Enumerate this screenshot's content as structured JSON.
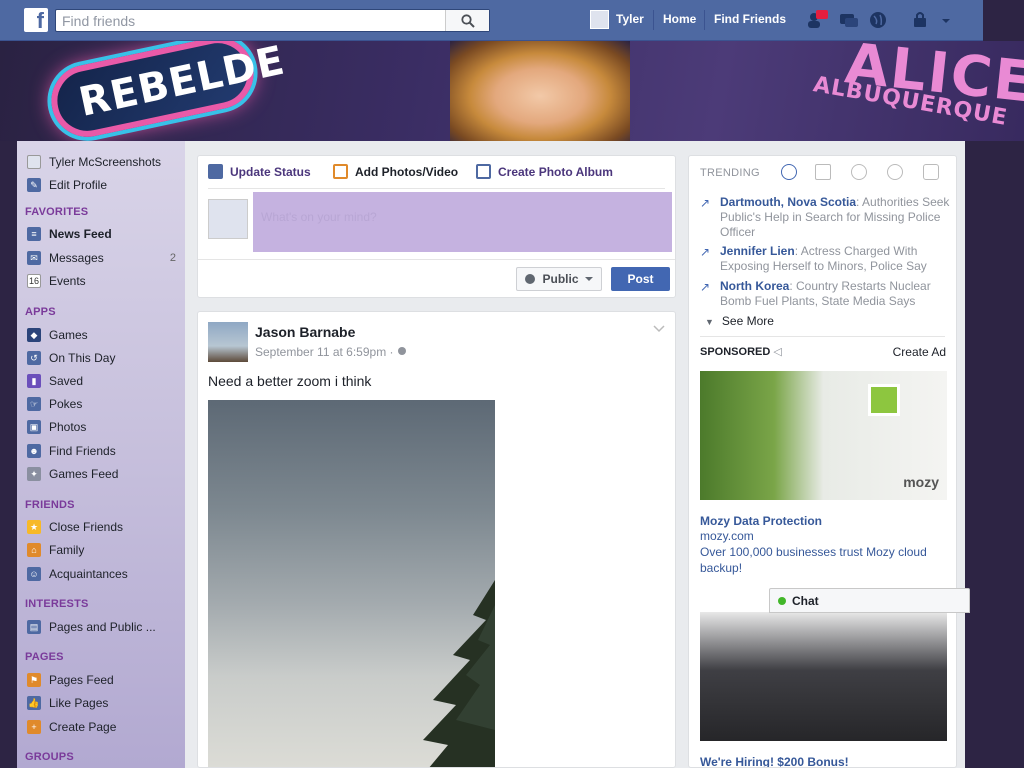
{
  "topbar": {
    "search_placeholder": "Find friends",
    "user_name": "Tyler",
    "home_label": "Home",
    "find_friends_label": "Find Friends"
  },
  "banner": {
    "logo_text": "REBELDE",
    "title_first": "ALICE",
    "title_last": "ALBUQUERQUE"
  },
  "sidebar": {
    "profile_name": "Tyler McScreenshots",
    "edit_profile": "Edit Profile",
    "favorites_title": "FAVORITES",
    "favorites": [
      {
        "label": "News Feed",
        "icon": "newsfeed-icon",
        "count": ""
      },
      {
        "label": "Messages",
        "icon": "messages-icon",
        "count": "2"
      },
      {
        "label": "Events",
        "icon": "events-icon",
        "count": ""
      }
    ],
    "apps_title": "APPS",
    "apps": [
      {
        "label": "Games",
        "icon": "games-icon"
      },
      {
        "label": "On This Day",
        "icon": "on-this-day-icon"
      },
      {
        "label": "Saved",
        "icon": "saved-icon"
      },
      {
        "label": "Pokes",
        "icon": "pokes-icon"
      },
      {
        "label": "Photos",
        "icon": "photos-icon"
      },
      {
        "label": "Find Friends",
        "icon": "find-friends-icon"
      },
      {
        "label": "Games Feed",
        "icon": "games-feed-icon"
      }
    ],
    "friends_title": "FRIENDS",
    "friends": [
      {
        "label": "Close Friends",
        "icon": "star-icon"
      },
      {
        "label": "Family",
        "icon": "family-icon"
      },
      {
        "label": "Acquaintances",
        "icon": "acquaintances-icon"
      }
    ],
    "interests_title": "INTERESTS",
    "interests": [
      {
        "label": "Pages and Public ...",
        "icon": "pages-public-icon"
      }
    ],
    "pages_title": "PAGES",
    "pages": [
      {
        "label": "Pages Feed",
        "icon": "pages-feed-icon"
      },
      {
        "label": "Like Pages",
        "icon": "like-icon"
      },
      {
        "label": "Create Page",
        "icon": "create-page-icon"
      }
    ],
    "groups_title": "GROUPS"
  },
  "composer": {
    "tab_status": "Update Status",
    "tab_photos": "Add Photos/Video",
    "tab_album": "Create Photo Album",
    "placeholder": "What's on your mind?",
    "audience": "Public",
    "post_button": "Post"
  },
  "post": {
    "author": "Jason Barnabe",
    "timestamp": "September 11 at 6:59pm · ",
    "text": "Need a better zoom i think"
  },
  "trending": {
    "title": "TRENDING",
    "items": [
      {
        "topic": "Dartmouth, Nova Scotia",
        "desc": ": Authorities Seek Public's Help in Search for Missing Police Officer"
      },
      {
        "topic": "Jennifer Lien",
        "desc": ": Actress Charged With Exposing Herself to Minors, Police Say"
      },
      {
        "topic": "North Korea",
        "desc": ": Country Restarts Nuclear Bomb Fuel Plants, State Media Says"
      }
    ],
    "see_more": "See More"
  },
  "sponsored": {
    "title": "SPONSORED",
    "create_ad": "Create Ad",
    "ad1": {
      "title": "Mozy Data Protection",
      "url": "mozy.com",
      "desc": "Over 100,000 businesses trust Mozy cloud backup!",
      "brand": "mozy"
    },
    "ad2": {
      "title": "We're Hiring! $200 Bonus!"
    }
  },
  "chat": {
    "label": "Chat"
  },
  "colors": {
    "fb_blue": "#4e69a2",
    "link_blue": "#365899",
    "post_button": "#4267b2",
    "sidebar_heading": "#7a3a9a",
    "composer_input": "#c5b2e0"
  }
}
